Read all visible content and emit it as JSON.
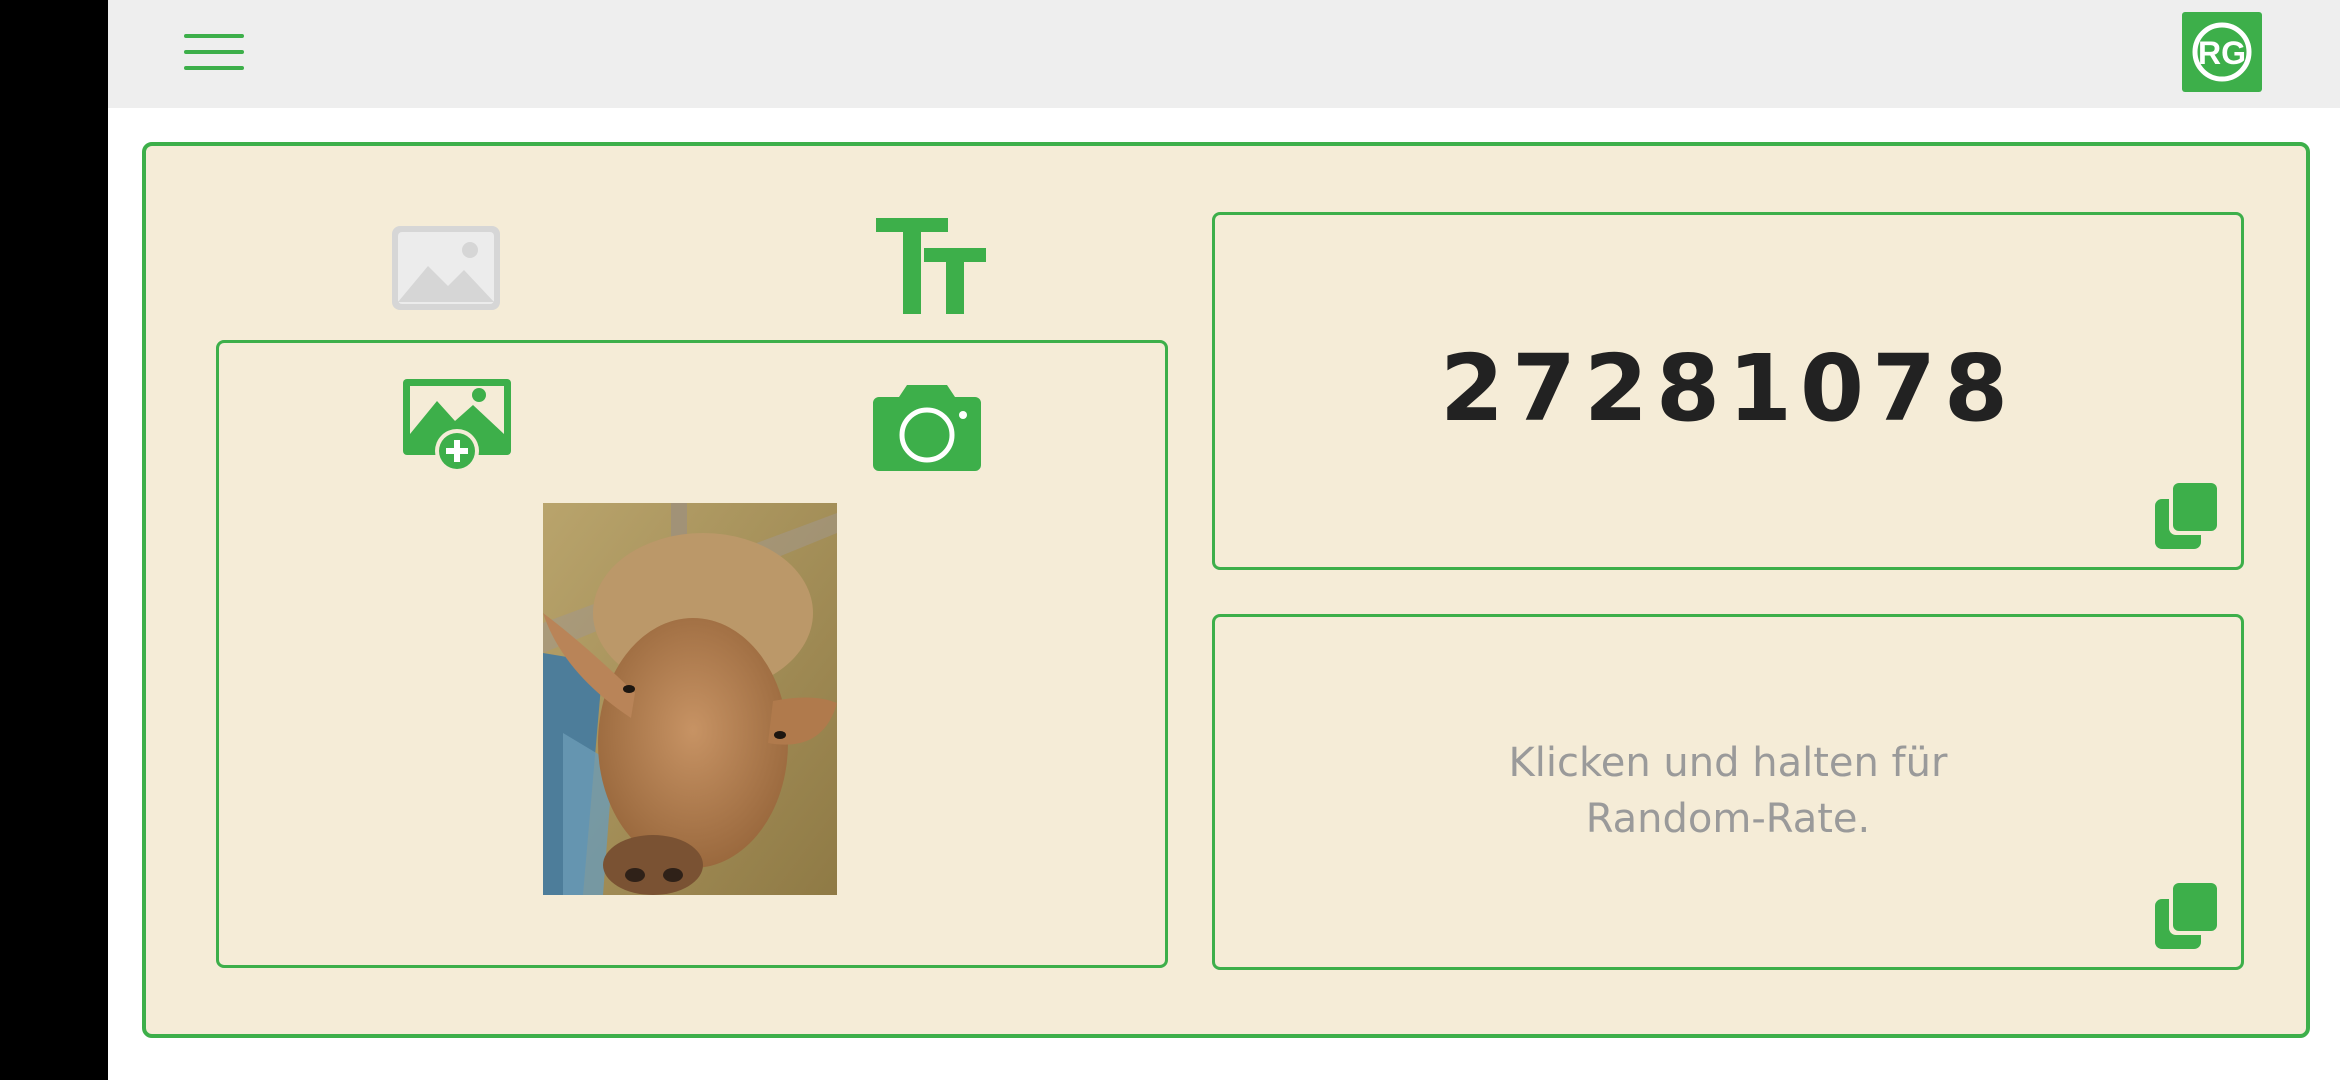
{
  "header": {
    "menu_icon": "hamburger-menu-icon",
    "logo_letters": "RG"
  },
  "modes": {
    "image_tab_icon": "image-icon",
    "text_tab_icon": "text-size-icon"
  },
  "image_input": {
    "add_image_icon": "add-image-icon",
    "camera_icon": "camera-icon"
  },
  "result": {
    "number": "27281078",
    "copy_icon": "copy-icon"
  },
  "random": {
    "hint_line1": "Klicken und halten für",
    "hint_line2": "Random-Rate.",
    "copy_icon": "copy-icon"
  },
  "colors": {
    "accent": "#3daf4a",
    "card_bg": "#f5ecd7",
    "topbar_bg": "#eeeeee",
    "hint_text": "#9a9a9a",
    "inactive_icon": "#d6d6d6"
  }
}
